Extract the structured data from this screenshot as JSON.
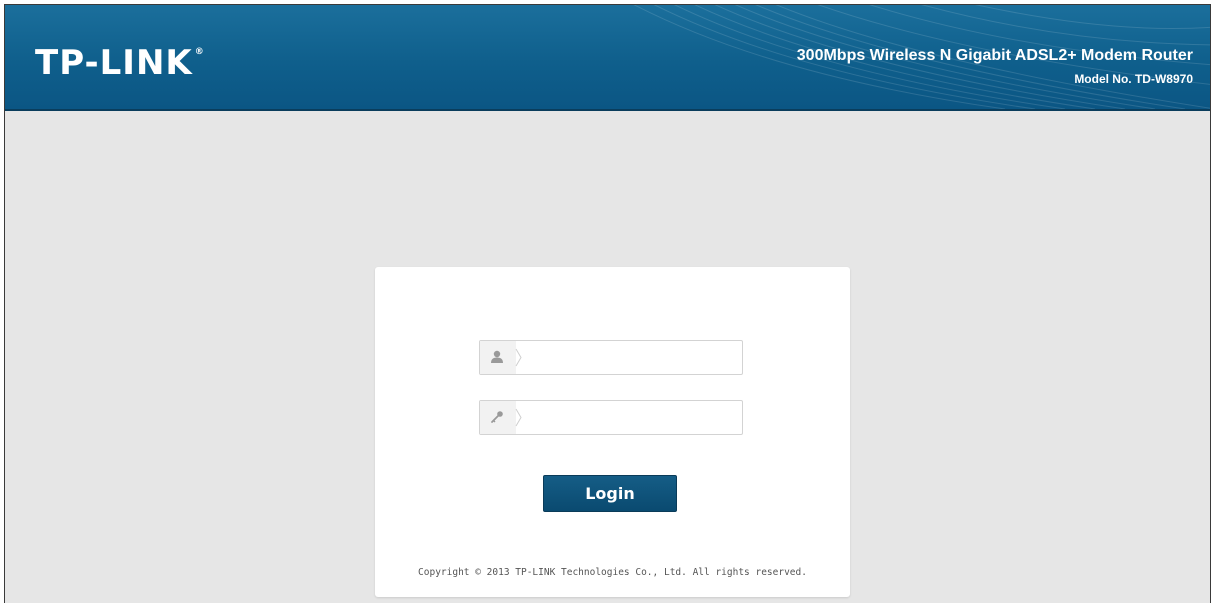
{
  "header": {
    "logo_text": "TP-LINK",
    "logo_mark": "®",
    "product_title": "300Mbps Wireless N Gigabit ADSL2+ Modem Router",
    "model_no": "Model No. TD-W8970"
  },
  "login": {
    "username": {
      "icon": "user-icon",
      "value": ""
    },
    "password": {
      "icon": "key-icon",
      "value": ""
    },
    "button_label": "Login",
    "copyright": "Copyright © 2013 TP-LINK Technologies Co., Ltd. All rights reserved."
  },
  "colors": {
    "header_blue": "#0f5f8c",
    "button_blue": "#0a4a70",
    "page_background": "#e6e6e6"
  }
}
